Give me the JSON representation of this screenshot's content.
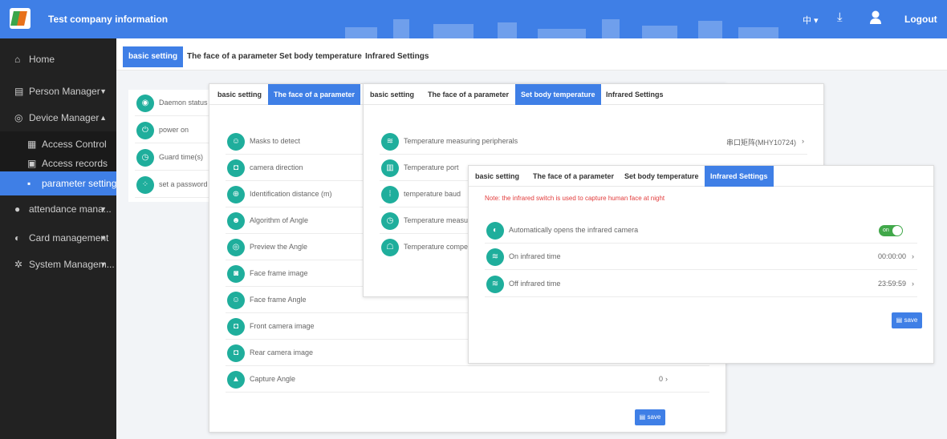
{
  "header": {
    "title": "Test company information",
    "lang": "中 ▾",
    "logout": "Logout"
  },
  "sidebar": {
    "items": [
      {
        "icon": "⌂",
        "label": "Home",
        "caret": ""
      },
      {
        "icon": "▤",
        "label": "Person Manager",
        "caret": "▼"
      },
      {
        "icon": "◎",
        "label": "Device Manager",
        "caret": "▲"
      },
      {
        "icon": "▦",
        "label": "Access Control",
        "caret": ""
      },
      {
        "icon": "▣",
        "label": "Access records",
        "caret": ""
      },
      {
        "icon": "▪",
        "label": "parameter setting",
        "caret": ""
      },
      {
        "icon": "●",
        "label": "attendance mana...",
        "caret": "▼"
      },
      {
        "icon": "◐",
        "label": "Card management",
        "caret": "▼"
      },
      {
        "icon": "✲",
        "label": "System Managem...",
        "caret": "▼"
      }
    ]
  },
  "tabs": [
    "basic setting",
    "The face of a parameter",
    "Set body temperature",
    "Infrared Settings"
  ],
  "basic_panel": {
    "rows": [
      "Daemon status",
      "power on",
      "Guard time(s)",
      "set a password"
    ]
  },
  "face_panel": {
    "tabs": [
      "basic setting",
      "The face of a parameter"
    ],
    "rows": [
      {
        "label": "Masks to detect",
        "value": ""
      },
      {
        "label": "camera direction",
        "value": ""
      },
      {
        "label": "Identification distance (m)",
        "value": ""
      },
      {
        "label": "Algorithm of Angle",
        "value": ""
      },
      {
        "label": "Preview the Angle",
        "value": ""
      },
      {
        "label": "Face frame image",
        "value": ""
      },
      {
        "label": "Face frame Angle",
        "value": ""
      },
      {
        "label": "Front camera image",
        "value": ""
      },
      {
        "label": "Rear camera image",
        "value": ""
      },
      {
        "label": "Capture Angle",
        "value": "0"
      }
    ],
    "save": "save"
  },
  "temp_panel": {
    "tabs": [
      "basic setting",
      "The face of a parameter",
      "Set body temperature",
      "Infrared Settings"
    ],
    "rows": [
      {
        "label": "Temperature measuring peripherals",
        "value": "串口矩阵(MHY10724)"
      },
      {
        "label": "Temperature port",
        "value": ""
      },
      {
        "label": "temperature baud",
        "value": ""
      },
      {
        "label": "Temperature measure",
        "value": ""
      },
      {
        "label": "Temperature compens",
        "value": ""
      }
    ]
  },
  "infrared_panel": {
    "tabs": [
      "basic setting",
      "The face of a parameter",
      "Set body temperature",
      "Infrared Settings"
    ],
    "note": "Note: the infrared switch is used to capture human face at night",
    "rows": [
      {
        "label": "Automatically opens the infrared camera",
        "value": ""
      },
      {
        "label": "On infrared time",
        "value": "00:00:00"
      },
      {
        "label": "Off infrared time",
        "value": "23:59:59"
      }
    ],
    "toggle": "on",
    "save": "save"
  },
  "colors": {
    "accent": "#3f7fe6",
    "sidebar": "#222222",
    "icon_teal": "#1fae9c",
    "toggle_green": "#41a84a",
    "note_red": "#e23b3b"
  }
}
